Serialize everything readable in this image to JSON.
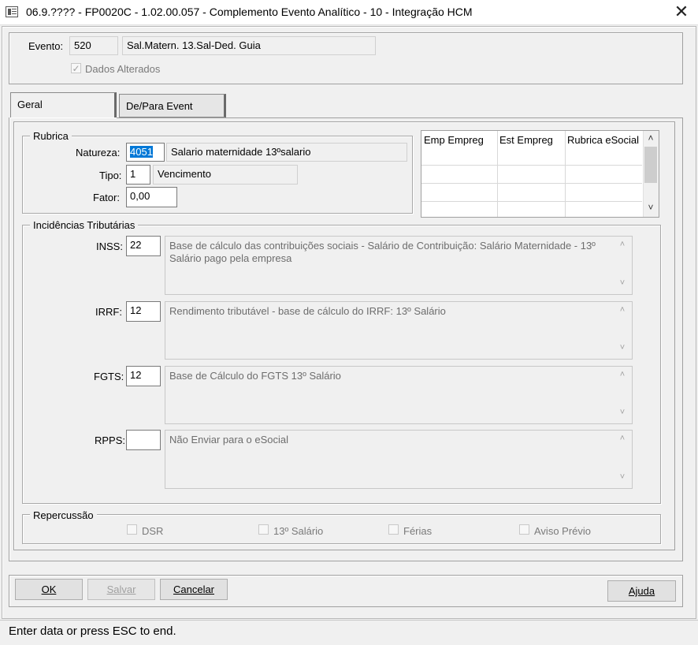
{
  "window": {
    "title": "06.9.???? - FP0020C - 1.02.00.057 - Complemento Evento Analítico - 10 - Integração HCM",
    "close_symbol": "✕"
  },
  "header": {
    "evento_label": "Evento:",
    "evento_code": "520",
    "evento_desc": "Sal.Matern. 13.Sal-Ded. Guia",
    "dados_alterados_label": "Dados Alterados",
    "dados_alterados_checked": true
  },
  "tabs": [
    {
      "label": "Geral",
      "active": true
    },
    {
      "label": "De/Para Event",
      "active": false
    }
  ],
  "rubrica": {
    "group_title": "Rubrica",
    "natureza_label": "Natureza:",
    "natureza_value": "4051",
    "natureza_desc": "Salario maternidade  13ºsalario",
    "tipo_label": "Tipo:",
    "tipo_value": "1",
    "tipo_desc": "Vencimento",
    "fator_label": "Fator:",
    "fator_value": "0,00"
  },
  "grid": {
    "columns": [
      "Emp Empreg",
      "Est Empreg",
      "Rubrica eSocial"
    ]
  },
  "incidencias": {
    "group_title": "Incidências Tributárias",
    "rows": [
      {
        "label": "INSS:",
        "value": "22",
        "desc": "Base de cálculo das contribuições sociais - Salário de Contribuição: Salário Maternidade - 13º Salário pago pela empresa"
      },
      {
        "label": "IRRF:",
        "value": "12",
        "desc": "Rendimento tributável - base de cálculo do IRRF: 13º Salário"
      },
      {
        "label": "FGTS:",
        "value": "12",
        "desc": "Base de Cálculo do FGTS 13º Salário"
      },
      {
        "label": "RPPS:",
        "value": "",
        "desc": "Não Enviar para o eSocial"
      }
    ]
  },
  "repercussao": {
    "group_title": "Repercussão",
    "items": [
      "DSR",
      "13º Salário",
      "Férias",
      "Aviso Prévio"
    ]
  },
  "buttons": {
    "ok": "OK",
    "salvar": "Salvar",
    "cancelar": "Cancelar",
    "ajuda": "Ajuda"
  },
  "status": {
    "text": "Enter data or press ESC to end."
  }
}
